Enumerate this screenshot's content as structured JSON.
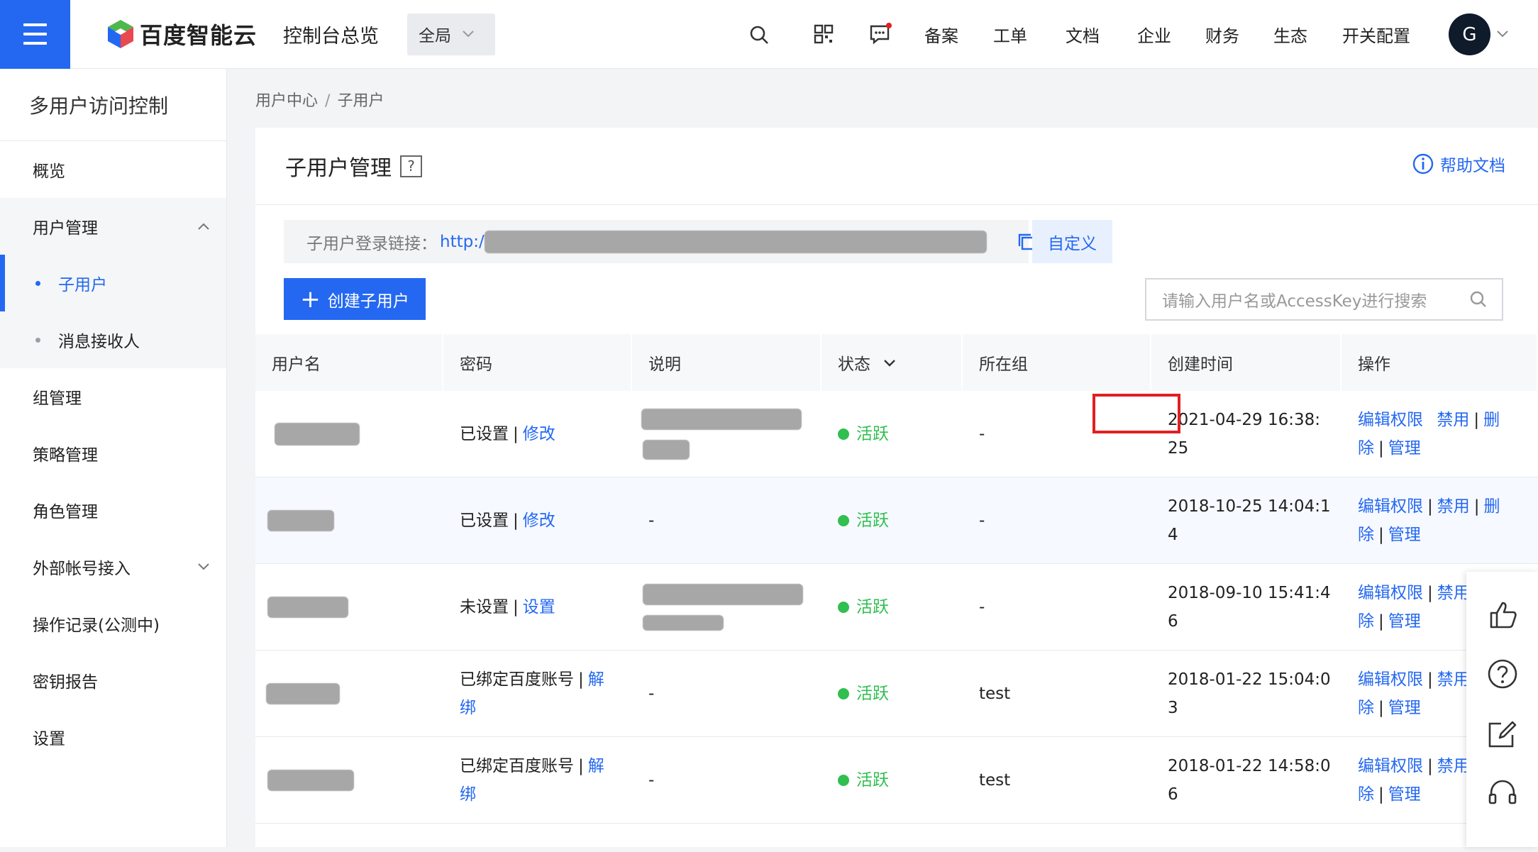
{
  "header": {
    "brand": "百度智能云",
    "console_title": "控制台总览",
    "region": "全局",
    "nav": [
      "备案",
      "工单",
      "文档",
      "企业",
      "财务",
      "生态",
      "开关配置"
    ],
    "avatar_letter": "G",
    "accent": "#2468f2"
  },
  "sidebar": {
    "title": "多用户访问控制",
    "items": [
      {
        "label": "概览"
      },
      {
        "label": "用户管理"
      },
      {
        "label": "子用户"
      },
      {
        "label": "消息接收人"
      },
      {
        "label": "组管理"
      },
      {
        "label": "策略管理"
      },
      {
        "label": "角色管理"
      },
      {
        "label": "外部帐号接入"
      },
      {
        "label": "操作记录(公测中)"
      },
      {
        "label": "密钥报告"
      },
      {
        "label": "设置"
      }
    ]
  },
  "breadcrumb": {
    "root": "用户中心",
    "sep": "/",
    "current": "子用户"
  },
  "page": {
    "title": "子用户管理",
    "help_mark": "?",
    "help_doc": "帮助文档",
    "login_label": "子用户登录链接：",
    "login_url": "http:/",
    "custom_label": "自定义",
    "create_label": "创建子用户",
    "search_placeholder": "请输入用户名或AccessKey进行搜索"
  },
  "table": {
    "columns": [
      "用户名",
      "密码",
      "说明",
      "状态",
      "所在组",
      "创建时间",
      "操作"
    ],
    "rows": [
      {
        "pwd": "已设置",
        "pwd_action": "修改",
        "desc": "",
        "status": "活跃",
        "group": "-",
        "created_1": "2021-04-29 16:38:",
        "created_2": "25"
      },
      {
        "pwd": "已设置",
        "pwd_action": "修改",
        "desc": "-",
        "status": "活跃",
        "group": "-",
        "created_1": "2018-10-25 14:04:1",
        "created_2": "4"
      },
      {
        "pwd": "未设置",
        "pwd_action": "设置",
        "desc": "",
        "status": "活跃",
        "group": "-",
        "created_1": "2018-09-10 15:41:4",
        "created_2": "6"
      },
      {
        "pwd": "已绑定百度账号",
        "pwd_action_1": "解",
        "pwd_action_2": "绑",
        "desc": "-",
        "status": "活跃",
        "group": "test",
        "created_1": "2018-01-22 15:04:0",
        "created_2": "3"
      },
      {
        "pwd": "已绑定百度账号",
        "pwd_action_1": "解",
        "pwd_action_2": "绑",
        "desc": "-",
        "status": "活跃",
        "group": "test",
        "created_1": "2018-01-22 14:58:0",
        "created_2": "6"
      }
    ],
    "ops": {
      "edit": "编辑权限",
      "disable": "禁用",
      "del_1": "删",
      "del_2": "除",
      "manage": "管理",
      "disable_cut": "禁用"
    }
  },
  "status_color": "#30bf50"
}
